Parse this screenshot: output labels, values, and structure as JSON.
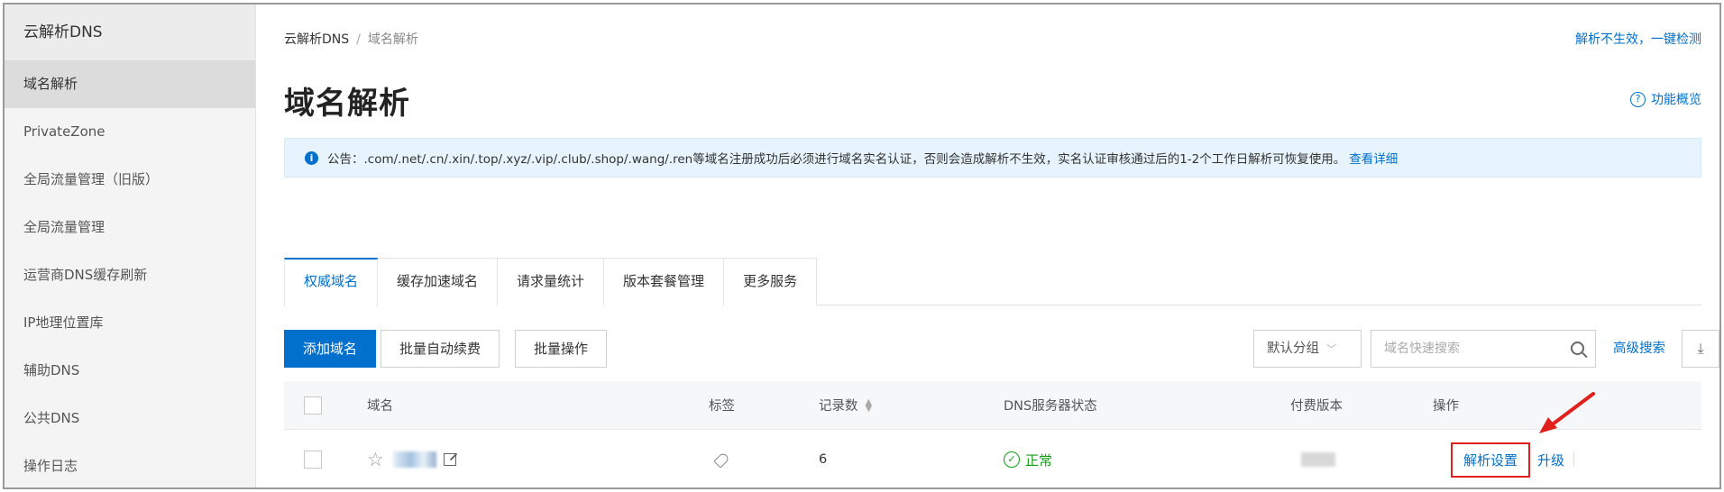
{
  "sidebar": {
    "title": "云解析DNS",
    "items": [
      {
        "label": "域名解析",
        "active": true
      },
      {
        "label": "PrivateZone"
      },
      {
        "label": "全局流量管理（旧版）"
      },
      {
        "label": "全局流量管理"
      },
      {
        "label": "运营商DNS缓存刷新"
      },
      {
        "label": "IP地理位置库"
      },
      {
        "label": "辅助DNS"
      },
      {
        "label": "公共DNS"
      },
      {
        "label": "操作日志"
      }
    ]
  },
  "breadcrumb": {
    "root": "云解析DNS",
    "separator": "/",
    "current": "域名解析"
  },
  "header": {
    "top_link": "解析不生效，一键检测",
    "title": "域名解析",
    "overview_label": "功能概览"
  },
  "notice": {
    "text": "公告：.com/.net/.cn/.xin/.top/.xyz/.vip/.club/.shop/.wang/.ren等域名注册成功后必须进行域名实名认证，否则会造成解析不生效，实名认证审核通过后的1-2个工作日解析可恢复使用。",
    "link": "查看详细"
  },
  "tabs": [
    {
      "label": "权威域名",
      "active": true
    },
    {
      "label": "缓存加速域名"
    },
    {
      "label": "请求量统计"
    },
    {
      "label": "版本套餐管理"
    },
    {
      "label": "更多服务"
    }
  ],
  "toolbar": {
    "add_label": "添加域名",
    "renew_label": "批量自动续费",
    "batch_label": "批量操作",
    "group_select": "默认分组",
    "search_placeholder": "域名快速搜索",
    "advanced_search": "高级搜索"
  },
  "table": {
    "headers": {
      "domain": "域名",
      "tag": "标签",
      "records": "记录数",
      "dns_status": "DNS服务器状态",
      "version": "付费版本",
      "actions": "操作"
    },
    "rows": [
      {
        "records": "6",
        "status": "正常",
        "action_primary": "解析设置",
        "action_secondary": "升级"
      }
    ]
  },
  "colors": {
    "primary": "#0070cc",
    "success": "#12a012",
    "highlight": "#e0201c"
  },
  "icons": [
    "info-icon",
    "question-icon",
    "search-icon",
    "download-icon",
    "star-icon",
    "edit-icon",
    "tag-icon",
    "check-circle-icon",
    "sort-icon",
    "arrow-annotation"
  ]
}
